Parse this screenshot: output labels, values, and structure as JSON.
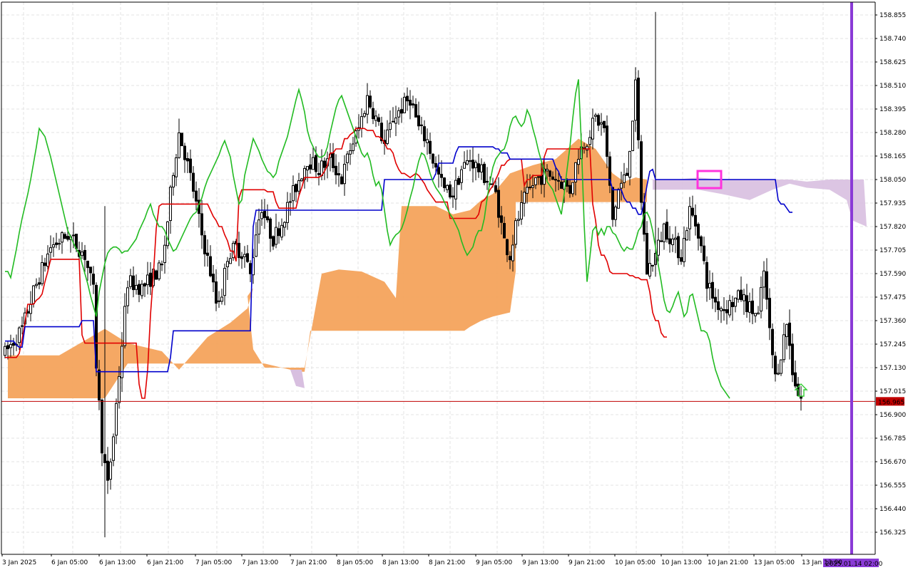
{
  "chart_data": {
    "type": "candlestick",
    "title": "",
    "y_axis": {
      "range": [
        156.266,
        158.905
      ],
      "ticks": [
        "158.855",
        "158.740",
        "158.625",
        "158.510",
        "158.395",
        "158.280",
        "158.165",
        "158.050",
        "157.935",
        "157.820",
        "157.705",
        "157.590",
        "157.475",
        "157.360",
        "157.245",
        "157.130",
        "157.015",
        "156.900",
        "156.785",
        "156.670",
        "156.555",
        "156.440",
        "156.325"
      ]
    },
    "x_axis": {
      "ticks": [
        "3 Jan 2025",
        "6 Jan 05:00",
        "6 Jan 13:00",
        "6 Jan 21:00",
        "7 Jan 05:00",
        "7 Jan 13:00",
        "7 Jan 21:00",
        "8 Jan 05:00",
        "8 Jan 13:00",
        "8 Jan 21:00",
        "9 Jan 05:00",
        "9 Jan 13:00",
        "9 Jan 21:00",
        "10 Jan 05:00",
        "10 Jan 13:00",
        "10 Jan 21:00",
        "13 Jan 05:00",
        "13 Jan 13:00"
      ]
    },
    "current_price": {
      "label": "156.965",
      "value": 156.965,
      "color": "#c00000"
    },
    "time_marker": {
      "label": "2025.01.14 02:00",
      "color": "#8a3ad6"
    },
    "grid": true,
    "colors": {
      "bull_body": "#ffffff",
      "bear_body": "#000000",
      "cloud_bull": "#f4a35c",
      "cloud_bear": "#d8bfe0",
      "tenkan": "#e00000",
      "kijun": "#0000cc",
      "chikou": "#22bb22",
      "highlight_box": "#ff33dd",
      "signal_arrow": "#33cc33"
    },
    "series": [
      {
        "name": "",
        "role": "tenkan",
        "color": "#e00000",
        "values": [
          157.18,
          157.18,
          157.18,
          157.18,
          157.18,
          157.2,
          157.27,
          157.35,
          157.44,
          157.44,
          157.44,
          157.46,
          157.47,
          157.49,
          157.55,
          157.6,
          157.66,
          157.66,
          157.66,
          157.66,
          157.66,
          157.66,
          157.66,
          157.66,
          157.66,
          157.66,
          157.66,
          157.29,
          157.25,
          157.25,
          157.25,
          157.25,
          157.25,
          157.25,
          157.25,
          157.25,
          157.25,
          157.25,
          157.25,
          157.25,
          157.25,
          157.25,
          157.25,
          157.25,
          157.25,
          157.25,
          157.25,
          157.05,
          156.98,
          156.98,
          157.12,
          157.39,
          157.58,
          157.81,
          157.92,
          157.93,
          157.93,
          157.93,
          157.93,
          157.93,
          157.93,
          157.93,
          157.93,
          157.93,
          157.93,
          157.93,
          157.93,
          157.93,
          157.93,
          157.93,
          157.93,
          157.93,
          157.9,
          157.87,
          157.85,
          157.82,
          157.82,
          157.78,
          157.75,
          157.7,
          157.7,
          157.65,
          157.96,
          158.0,
          158.0,
          158.0,
          158.0,
          158.0,
          158.0,
          158.0,
          158.0,
          158.0,
          157.99,
          157.99,
          157.99,
          157.94,
          157.91,
          157.91,
          157.91,
          157.91,
          157.91,
          157.91,
          157.91,
          157.97,
          158.01,
          158.06,
          158.06,
          158.06,
          158.06,
          158.06,
          158.06,
          158.07,
          158.09,
          158.12,
          158.18,
          158.18,
          158.2,
          158.2,
          158.2,
          158.25,
          158.25,
          158.27,
          158.28,
          158.3,
          158.3,
          158.3,
          158.3,
          158.29,
          158.29,
          158.29,
          158.26,
          158.26,
          158.25,
          158.23,
          158.2,
          158.2,
          158.18,
          158.13,
          158.1,
          158.08,
          158.08,
          158.07,
          158.06,
          158.07,
          158.08,
          158.07,
          158.05,
          158.03,
          158.0,
          157.98,
          157.96,
          157.94,
          157.94,
          157.94,
          157.94,
          157.94,
          157.86,
          157.86,
          157.86,
          157.86,
          157.86,
          157.86,
          157.86,
          157.86,
          157.86,
          157.86,
          157.88,
          157.94,
          157.95,
          157.97,
          158.0,
          158.02,
          158.05,
          158.08,
          158.12,
          158.12,
          158.14,
          158.15,
          158.15,
          158.15,
          158.15,
          158.15,
          158.02,
          158.05,
          158.05,
          158.07,
          158.07,
          158.07,
          158.07,
          158.16,
          158.2,
          158.2,
          158.2,
          158.2,
          158.2,
          158.2,
          158.2,
          158.2,
          158.2,
          158.2,
          158.2,
          158.2,
          158.2,
          158.2,
          158.2,
          158.2,
          157.93,
          157.85,
          157.73,
          157.68,
          157.68,
          157.65,
          157.6,
          157.59,
          157.59,
          157.59,
          157.59,
          157.59,
          157.59,
          157.58,
          157.58,
          157.57,
          157.57,
          157.56,
          157.56,
          157.56,
          157.5,
          157.4,
          157.36,
          157.36,
          157.3,
          157.28,
          157.28
        ]
      },
      {
        "name": "",
        "role": "kijun",
        "color": "#0000cc",
        "values": [
          157.26,
          157.26,
          157.26,
          157.26,
          157.24,
          157.23,
          157.23,
          157.33,
          157.33,
          157.33,
          157.33,
          157.33,
          157.33,
          157.33,
          157.33,
          157.33,
          157.33,
          157.33,
          157.33,
          157.33,
          157.33,
          157.33,
          157.33,
          157.33,
          157.33,
          157.33,
          157.33,
          157.36,
          157.36,
          157.36,
          157.36,
          157.36,
          157.11,
          157.11,
          157.11,
          157.11,
          157.11,
          157.11,
          157.11,
          157.11,
          157.11,
          157.11,
          157.11,
          157.11,
          157.11,
          157.11,
          157.11,
          157.11,
          157.11,
          157.11,
          157.11,
          157.11,
          157.11,
          157.11,
          157.11,
          157.11,
          157.11,
          157.11,
          157.18,
          157.31,
          157.31,
          157.31,
          157.31,
          157.31,
          157.31,
          157.31,
          157.31,
          157.31,
          157.31,
          157.31,
          157.31,
          157.31,
          157.31,
          157.31,
          157.31,
          157.31,
          157.31,
          157.31,
          157.31,
          157.31,
          157.31,
          157.31,
          157.31,
          157.31,
          157.31,
          157.31,
          157.31,
          157.82,
          157.9,
          157.9,
          157.9,
          157.9,
          157.9,
          157.9,
          157.9,
          157.9,
          157.9,
          157.9,
          157.9,
          157.9,
          157.9,
          157.9,
          157.9,
          157.9,
          157.9,
          157.9,
          157.9,
          157.9,
          157.9,
          157.9,
          157.9,
          157.9,
          157.9,
          157.9,
          157.9,
          157.9,
          157.9,
          157.9,
          157.9,
          157.9,
          157.9,
          157.9,
          157.9,
          157.9,
          157.9,
          157.9,
          157.9,
          157.9,
          157.9,
          157.9,
          157.9,
          157.9,
          157.9,
          158.05,
          158.05,
          158.05,
          158.05,
          158.05,
          158.05,
          158.05,
          158.05,
          158.05,
          158.05,
          158.05,
          158.05,
          158.05,
          158.05,
          158.05,
          158.05,
          158.05,
          158.05,
          158.08,
          158.13,
          158.13,
          158.13,
          158.13,
          158.13,
          158.13,
          158.18,
          158.21,
          158.21,
          158.21,
          158.21,
          158.21,
          158.21,
          158.21,
          158.21,
          158.21,
          158.21,
          158.21,
          158.21,
          158.21,
          158.2,
          158.2,
          158.18,
          158.18,
          158.18,
          158.15,
          158.15,
          158.15,
          158.15,
          158.15,
          158.15,
          158.15,
          158.15,
          158.15,
          158.15,
          158.15,
          158.15,
          158.15,
          158.15,
          158.15,
          158.15,
          158.11,
          158.09,
          158.05,
          158.05,
          158.05,
          158.05,
          158.05,
          158.05,
          158.05,
          158.05,
          158.05,
          158.05,
          158.05,
          158.05,
          158.05,
          158.05,
          158.05,
          158.05,
          158.05,
          158.05,
          158.0,
          158.0,
          158.0,
          158.0,
          157.96,
          157.94,
          157.94,
          157.91,
          157.91,
          157.88,
          157.88,
          157.94,
          158.02,
          158.09,
          158.1,
          158.05,
          158.05,
          158.05,
          158.05,
          158.05,
          158.05,
          158.05,
          158.05,
          158.05,
          158.05,
          158.05,
          158.05,
          158.05,
          158.05,
          158.05,
          158.05,
          158.05,
          158.05,
          158.05,
          158.05,
          158.05,
          158.05,
          158.05,
          158.05,
          158.05,
          158.05,
          158.05,
          158.05,
          158.05,
          158.05,
          158.05,
          158.05,
          158.05,
          158.05,
          158.05,
          158.05,
          158.05,
          158.05,
          158.05,
          158.05,
          158.05,
          158.05,
          158.05,
          157.95,
          157.93,
          157.93,
          157.91,
          157.89,
          157.89
        ]
      },
      {
        "name": "",
        "role": "chikou",
        "color": "#22bb22",
        "values": [
          157.6,
          157.6,
          157.57,
          157.64,
          157.71,
          157.79,
          157.86,
          157.92,
          157.98,
          158.05,
          158.13,
          158.21,
          158.3,
          158.28,
          158.26,
          158.21,
          158.16,
          158.1,
          158.04,
          157.98,
          157.92,
          157.86,
          157.8,
          157.77,
          157.74,
          157.71,
          157.69,
          157.64,
          157.59,
          157.54,
          157.48,
          157.43,
          157.38,
          157.5,
          157.57,
          157.64,
          157.69,
          157.71,
          157.72,
          157.72,
          157.71,
          157.69,
          157.7,
          157.7,
          157.72,
          157.74,
          157.76,
          157.8,
          157.83,
          157.86,
          157.9,
          157.93,
          157.88,
          157.85,
          157.82,
          157.82,
          157.8,
          157.76,
          157.73,
          157.7,
          157.71,
          157.74,
          157.77,
          157.8,
          157.83,
          157.86,
          157.88,
          157.89,
          157.93,
          157.96,
          158.01,
          158.05,
          158.08,
          158.11,
          158.14,
          158.17,
          158.21,
          158.24,
          158.2,
          158.16,
          158.07,
          158.0,
          157.93,
          157.95,
          158.07,
          158.13,
          158.19,
          158.25,
          158.22,
          158.19,
          158.15,
          158.12,
          158.09,
          158.08,
          158.06,
          158.08,
          158.14,
          158.18,
          158.22,
          158.26,
          158.32,
          158.38,
          158.44,
          158.49,
          158.44,
          158.38,
          158.29,
          158.24,
          158.21,
          158.18,
          158.16,
          158.16,
          158.17,
          158.21,
          158.28,
          158.34,
          158.4,
          158.44,
          158.46,
          158.42,
          158.38,
          158.34,
          158.3,
          158.26,
          158.22,
          158.18,
          158.16,
          158.18,
          158.14,
          158.07,
          158.02,
          158.04,
          158.0,
          157.9,
          157.8,
          157.73,
          157.76,
          157.78,
          157.79,
          157.81,
          157.85,
          157.9,
          157.96,
          158.01,
          158.08,
          158.14,
          158.18,
          158.17,
          158.13,
          158.08,
          158.04,
          158.01,
          157.99,
          157.97,
          157.94,
          157.91,
          157.88,
          157.86,
          157.83,
          157.8,
          157.75,
          157.71,
          157.68,
          157.7,
          157.72,
          157.77,
          157.8,
          157.8,
          157.86,
          157.96,
          158.04,
          158.11,
          158.15,
          158.17,
          158.19,
          158.2,
          158.24,
          158.31,
          158.35,
          158.36,
          158.33,
          158.31,
          158.33,
          158.39,
          158.36,
          158.3,
          158.25,
          158.19,
          158.14,
          158.09,
          158.04,
          158.02,
          158.0,
          157.96,
          157.92,
          157.88,
          157.98,
          158.1,
          158.21,
          158.35,
          158.47,
          158.54,
          158.23,
          157.83,
          157.55,
          157.67,
          157.8,
          157.82,
          157.78,
          157.81,
          157.78,
          157.82,
          157.82,
          157.79,
          157.78,
          157.75,
          157.72,
          157.7,
          157.72,
          157.71,
          157.71,
          157.75,
          157.8,
          157.82,
          157.88,
          157.89,
          157.86,
          157.8,
          157.72,
          157.63,
          157.55,
          157.46,
          157.41,
          157.4,
          157.43,
          157.47,
          157.5,
          157.44,
          157.38,
          157.4,
          157.48,
          157.49,
          157.43,
          157.37,
          157.31,
          157.31,
          157.3,
          157.26,
          157.18,
          157.12,
          157.08,
          157.04,
          157.02,
          157.0,
          156.98
        ]
      }
    ],
    "annotations": [
      {
        "type": "rectangle",
        "label": "",
        "color": "#ff33dd"
      },
      {
        "type": "up-arrow",
        "label": "",
        "color": "#33cc33"
      }
    ]
  }
}
